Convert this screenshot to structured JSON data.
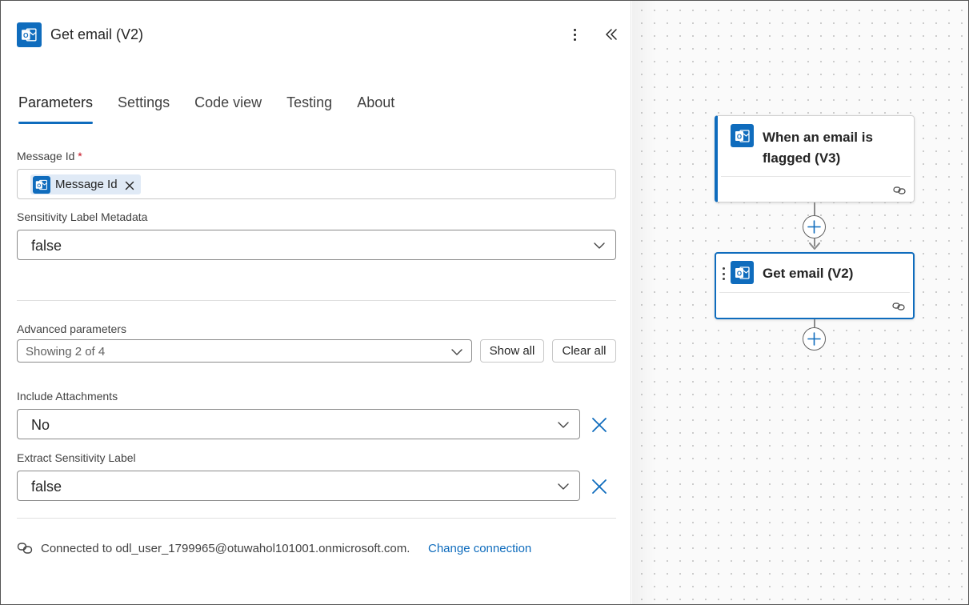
{
  "panel": {
    "title": "Get email (V2)",
    "tabs": [
      {
        "label": "Parameters",
        "active": true
      },
      {
        "label": "Settings",
        "active": false
      },
      {
        "label": "Code view",
        "active": false
      },
      {
        "label": "Testing",
        "active": false
      },
      {
        "label": "About",
        "active": false
      }
    ],
    "message_id": {
      "label": "Message Id",
      "required_mark": "*",
      "token": "Message Id"
    },
    "sensitivity_label_metadata": {
      "label": "Sensitivity Label Metadata",
      "value": "false"
    },
    "advanced": {
      "label": "Advanced parameters",
      "value": "Showing 2 of 4",
      "show_all": "Show all",
      "clear_all": "Clear all"
    },
    "include_attachments": {
      "label": "Include Attachments",
      "value": "No"
    },
    "extract_sensitivity_label": {
      "label": "Extract Sensitivity Label",
      "value": "false"
    },
    "connection": {
      "text": "Connected to odl_user_1799965@otuwahol101001.onmicrosoft.com.",
      "link": "Change connection"
    }
  },
  "canvas": {
    "trigger_card": {
      "title_line1": "When an email is",
      "title_line2": "flagged (V3)"
    },
    "action_card": {
      "title": "Get email (V2)",
      "selected": true
    }
  },
  "colors": {
    "accent": "#0f6cbd",
    "required": "#c50f1f",
    "token_bg": "#e0eaf6"
  },
  "icons": [
    "outlook-icon",
    "more-options-icon",
    "collapse-panel-icon",
    "dismiss-icon",
    "chevron-down-icon",
    "link-icon",
    "add-icon",
    "drag-handle-icon"
  ]
}
